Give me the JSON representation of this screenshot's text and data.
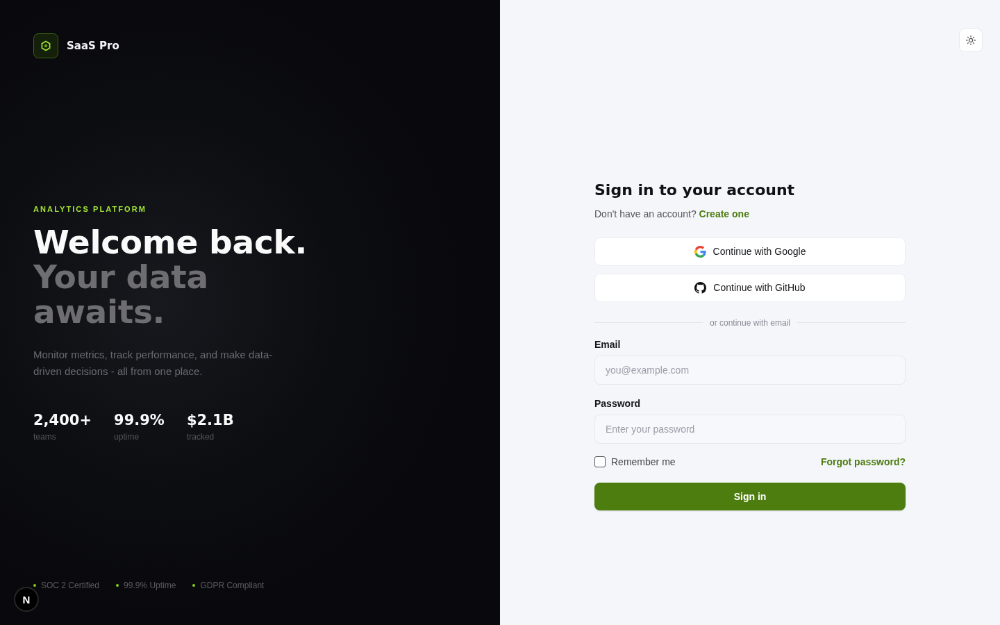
{
  "brand": {
    "name": "SaaS Pro"
  },
  "hero": {
    "eyebrow": "ANALYTICS PLATFORM",
    "title": "Welcome back.",
    "title_accent": "Your data awaits.",
    "description": "Monitor metrics, track performance, and make data-driven decisions - all from one place."
  },
  "stats": [
    {
      "value": "2,400+",
      "label": "teams"
    },
    {
      "value": "99.9%",
      "label": "uptime"
    },
    {
      "value": "$2.1B",
      "label": "tracked"
    }
  ],
  "badges": [
    "SOC 2 Certified",
    "99.9% Uptime",
    "GDPR Compliant"
  ],
  "dev_indicator": {
    "label": "N"
  },
  "form": {
    "title": "Sign in to your account",
    "prompt": "Don't have an account?",
    "prompt_link": "Create one",
    "providers": [
      {
        "kind": "google",
        "label": "Continue with Google"
      },
      {
        "kind": "github",
        "label": "Continue with GitHub"
      }
    ],
    "divider": "or continue with email",
    "fields": [
      {
        "label": "Email",
        "placeholder": "you@example.com"
      },
      {
        "label": "Password",
        "placeholder": "Enter your password"
      }
    ],
    "remember": {
      "label": "Remember me",
      "checked": false
    },
    "forgot_link": "Forgot password?",
    "submit": "Sign in"
  }
}
